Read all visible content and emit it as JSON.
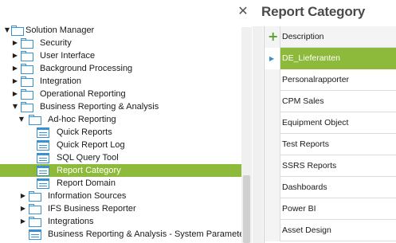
{
  "window": {
    "close_glyph": "✕"
  },
  "tree": {
    "nodes": [
      {
        "label": "Solution Manager",
        "expander": "▼",
        "icon": "folder-icon"
      },
      {
        "label": "Security",
        "expander": "▶",
        "icon": "folder-icon"
      },
      {
        "label": "User Interface",
        "expander": "▶",
        "icon": "folder-icon"
      },
      {
        "label": "Background Processing",
        "expander": "▶",
        "icon": "folder-icon"
      },
      {
        "label": "Integration",
        "expander": "▶",
        "icon": "folder-icon"
      },
      {
        "label": "Operational Reporting",
        "expander": "▶",
        "icon": "folder-icon"
      },
      {
        "label": "Business Reporting & Analysis",
        "expander": "▼",
        "icon": "folder-icon"
      },
      {
        "label": "Ad-hoc Reporting",
        "expander": "▼",
        "icon": "folder-icon"
      },
      {
        "label": "Quick Reports",
        "expander": "",
        "icon": "report-icon"
      },
      {
        "label": "Quick Report Log",
        "expander": "",
        "icon": "report-icon"
      },
      {
        "label": "SQL Query Tool",
        "expander": "",
        "icon": "report-icon"
      },
      {
        "label": "Report Category",
        "expander": "",
        "icon": "report-icon",
        "selected": true
      },
      {
        "label": "Report Domain",
        "expander": "",
        "icon": "report-icon"
      },
      {
        "label": "Information Sources",
        "expander": "▶",
        "icon": "folder-icon"
      },
      {
        "label": "IFS Business Reporter",
        "expander": "▶",
        "icon": "folder-icon"
      },
      {
        "label": "Integrations",
        "expander": "▶",
        "icon": "folder-icon"
      },
      {
        "label": "Business Reporting & Analysis - System Paramete",
        "expander": "",
        "icon": "report-icon"
      }
    ]
  },
  "report_pane": {
    "title": "Report Category",
    "add_glyph": "+",
    "active_glyph": "▶",
    "column_header": "Description",
    "rows": [
      {
        "description": "DE_Lieferanten",
        "active": true
      },
      {
        "description": "Personalrapporter"
      },
      {
        "description": "CPM Sales"
      },
      {
        "description": "Equipment Object"
      },
      {
        "description": "Test Reports"
      },
      {
        "description": "SSRS Reports"
      },
      {
        "description": "Dashboards"
      },
      {
        "description": "Power BI"
      },
      {
        "description": "Asset Design"
      }
    ]
  },
  "colors": {
    "selection": "#8dba3b",
    "icon_blue": "#3a8fd0",
    "add_green": "#5aa02c"
  }
}
